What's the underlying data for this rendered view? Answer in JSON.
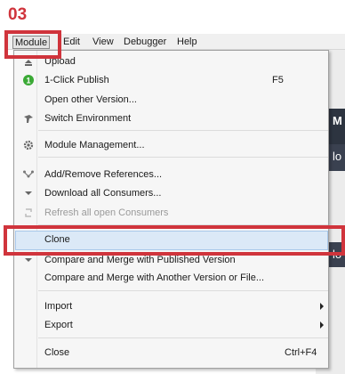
{
  "step": "03",
  "menubar": {
    "items": [
      "Module",
      "Edit",
      "View",
      "Debugger",
      "Help"
    ]
  },
  "module_menu": {
    "items": [
      {
        "label": "Upload",
        "icon": "upload-icon"
      },
      {
        "label": "1-Click Publish",
        "shortcut": "F5",
        "icon": "publish-badge-icon"
      },
      {
        "label": "Open other Version...",
        "icon": null
      },
      {
        "label": "Switch Environment",
        "icon": "switch-environment-icon"
      },
      {
        "label": "Module Management...",
        "icon": "gear-icon"
      },
      {
        "label": "Add/Remove References...",
        "icon": "references-icon"
      },
      {
        "label": "Download all Consumers...",
        "icon": "download-icon"
      },
      {
        "label": "Refresh all open Consumers",
        "icon": "refresh-icon",
        "disabled": true
      },
      {
        "label": "Clone",
        "icon": null,
        "hovered": true
      },
      {
        "label": "Compare and Merge with Published Version",
        "icon": "compare-icon"
      },
      {
        "label": "Compare and Merge with Another Version or File...",
        "icon": null
      },
      {
        "label": "Import",
        "submenu": true
      },
      {
        "label": "Export",
        "submenu": true
      },
      {
        "label": "Close",
        "shortcut": "Ctrl+F4"
      }
    ]
  },
  "background": {
    "right_fragments": [
      "M",
      "lo",
      "lo"
    ]
  },
  "colors": {
    "annotation": "#d0343c",
    "hover": "#dbe9f7",
    "publish_badge": "#3aa935"
  }
}
